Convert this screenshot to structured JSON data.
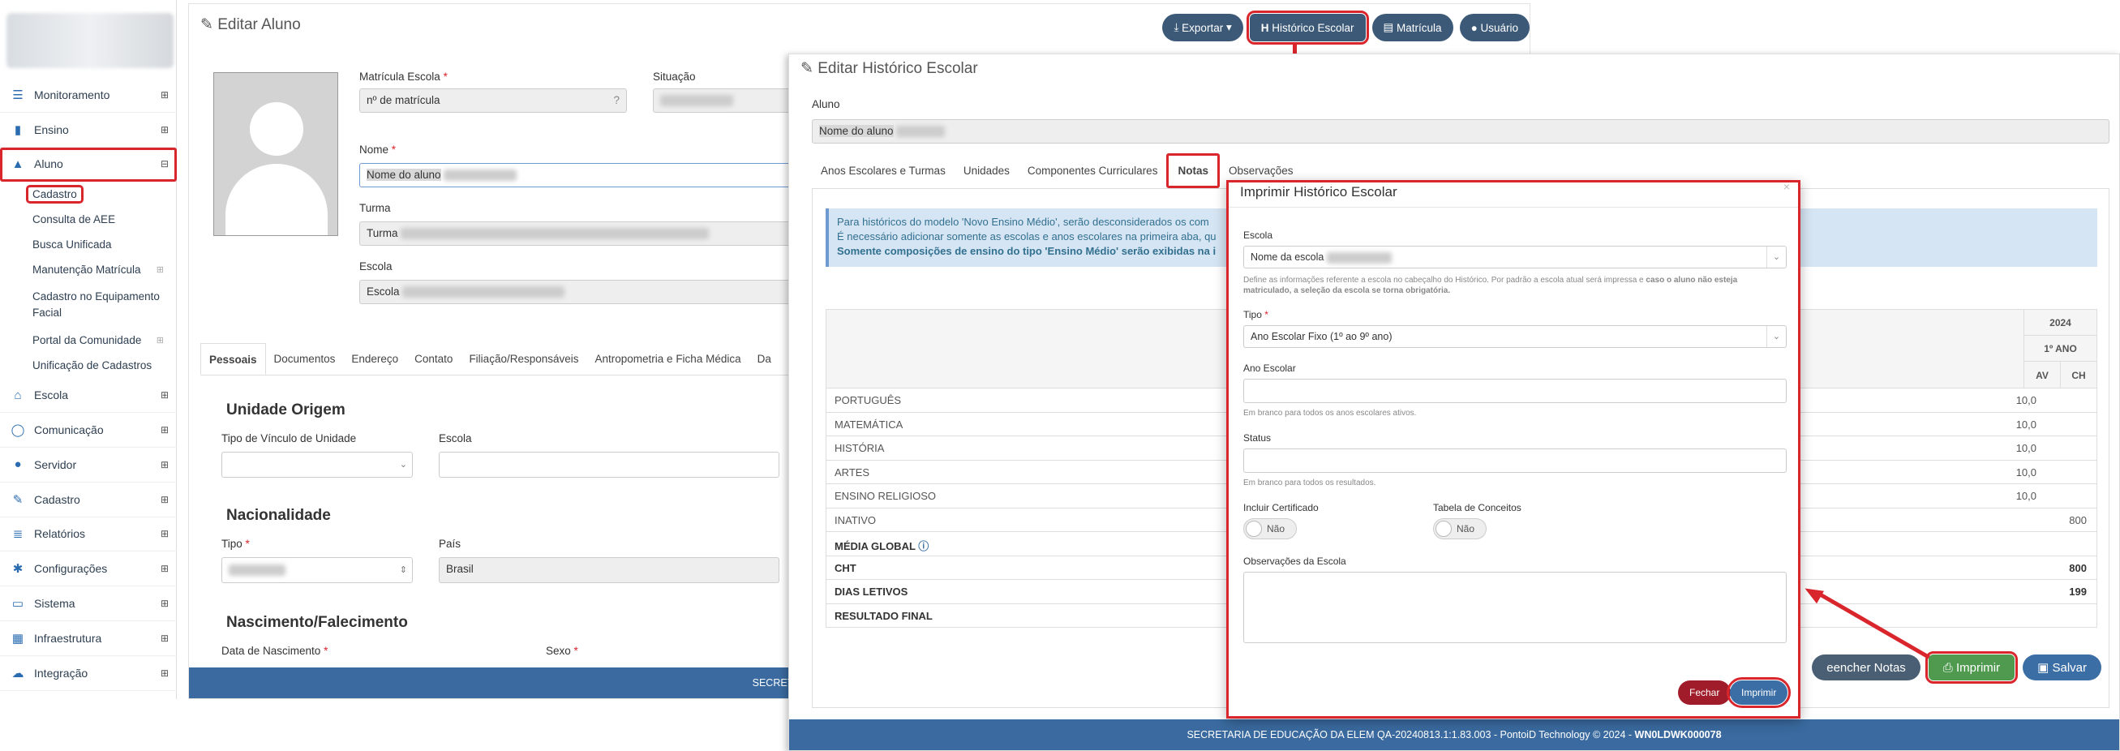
{
  "sidebar": {
    "items": [
      {
        "label": "Monitoramento",
        "icon": "sliders-icon"
      },
      {
        "label": "Ensino",
        "icon": "book-icon"
      },
      {
        "label": "Aluno",
        "icon": "graduation-cap-icon"
      },
      {
        "label": "Escola",
        "icon": "bank-icon"
      },
      {
        "label": "Comunicação",
        "icon": "chat-icon"
      },
      {
        "label": "Servidor",
        "icon": "user-icon"
      },
      {
        "label": "Cadastro",
        "icon": "edit-icon"
      },
      {
        "label": "Relatórios",
        "icon": "list-icon"
      },
      {
        "label": "Configurações",
        "icon": "gear-icon"
      },
      {
        "label": "Sistema",
        "icon": "monitor-icon"
      },
      {
        "label": "Infraestrutura",
        "icon": "building-icon"
      },
      {
        "label": "Integração",
        "icon": "cloud-icon"
      }
    ],
    "aluno_sub": [
      "Cadastro",
      "Consulta de AEE",
      "Busca Unificada",
      "Manutenção Matrícula",
      "Cadastro no Equipamento Facial",
      "Portal da Comunidade",
      "Unificação de Cadastros"
    ]
  },
  "main": {
    "title": "Editar Aluno",
    "buttons": {
      "exportar": "Exportar",
      "historico": "Histórico Escolar",
      "matricula": "Matrícula",
      "usuario": "Usuário"
    },
    "matricula_label": "Matrícula Escola",
    "matricula_value": "nº de matrícula",
    "situacao_label": "Situação",
    "nome_label": "Nome",
    "nome_value": "Nome do aluno",
    "turma_label": "Turma",
    "turma_value": "Turma",
    "escola_label": "Escola",
    "escola_value": "Escola",
    "tabs": [
      "Pessoais",
      "Documentos",
      "Endereço",
      "Contato",
      "Filiação/Responsáveis",
      "Antropometria e Ficha Médica",
      "Da"
    ],
    "unidade_title": "Unidade Origem",
    "tipo_vinculo_label": "Tipo de Vínculo de Unidade",
    "escola2_label": "Escola",
    "nacionalidade_title": "Nacionalidade",
    "tipo_label": "Tipo",
    "pais_label": "País",
    "pais_value": "Brasil",
    "nascimento_title": "Nascimento/Falecimento",
    "data_nasc_label": "Data de Nascimento",
    "sexo_label": "Sexo",
    "footer": "SECRETARIA DE EDUCAÇÃO DA ELEM QA-2"
  },
  "historico": {
    "title": "Editar Histórico Escolar",
    "aluno_label": "Aluno",
    "aluno_value": "Nome do aluno",
    "tabs": [
      "Anos Escolares e Turmas",
      "Unidades",
      "Componentes Curriculares",
      "Notas",
      "Observações"
    ],
    "info_line1": "Para históricos do modelo 'Novo Ensino Médio', serão desconsiderados os com",
    "info_line2": "É necessário adicionar somente as escolas e anos escolares na primeira aba, qu",
    "info_line3": "Somente composições de ensino do tipo 'Ensino Médio' serão exibidas na i",
    "year": "2024",
    "serie": "1º ANO",
    "col_av": "AV",
    "col_ch": "CH",
    "rows": [
      {
        "name": "PORTUGUÊS",
        "av": "10,0",
        "ch": ""
      },
      {
        "name": "MATEMÁTICA",
        "av": "10,0",
        "ch": ""
      },
      {
        "name": "HISTÓRIA",
        "av": "10,0",
        "ch": ""
      },
      {
        "name": "ARTES",
        "av": "10,0",
        "ch": ""
      },
      {
        "name": "ENSINO RELIGIOSO",
        "av": "10,0",
        "ch": ""
      },
      {
        "name": "INATIVO",
        "av": "",
        "ch": "800"
      },
      {
        "name": "MÉDIA GLOBAL",
        "av": "",
        "ch": ""
      },
      {
        "name": "CHT",
        "av": "",
        "ch": "800"
      },
      {
        "name": "DIAS LETIVOS",
        "av": "",
        "ch": "199"
      },
      {
        "name": "RESULTADO FINAL",
        "av": "",
        "ch": ""
      }
    ],
    "btn_preencher": "eencher Notas",
    "btn_imprimir": "Imprimir",
    "btn_salvar": "Salvar",
    "footer_main": "SECRETARIA DE EDUCAÇÃO DA ELEM QA-20240813.1:1.83.003 - PontoiD Technology © 2024 - ",
    "footer_code": "WN0LDWK000078"
  },
  "modal": {
    "title": "Imprimir Histórico Escolar",
    "escola_label": "Escola",
    "escola_value": "Nome da escola",
    "escola_help_1": "Define as informações referente a escola no cabeçalho do Histórico. Por padrão a escola atual será impressa e ",
    "escola_help_bold": "caso o aluno não esteja matriculado, a seleção da escola se torna obrigatória.",
    "tipo_label": "Tipo",
    "tipo_value": "Ano Escolar Fixo (1º ao 9º ano)",
    "ano_label": "Ano Escolar",
    "ano_help": "Em branco para todos os anos escolares ativos.",
    "status_label": "Status",
    "status_help": "Em branco para todos os resultados.",
    "certificado_label": "Incluir Certificado",
    "certificado_value": "Não",
    "conceitos_label": "Tabela de Conceitos",
    "conceitos_value": "Não",
    "obs_label": "Observações da Escola",
    "btn_fechar": "Fechar",
    "btn_imprimir": "Imprimir"
  },
  "colors": {
    "accent": "#3c5a78",
    "highlight": "#d9262c",
    "footer": "#3a6a9f",
    "imprimir": "#4f9a4f",
    "salvar": "#3b6ea5"
  }
}
